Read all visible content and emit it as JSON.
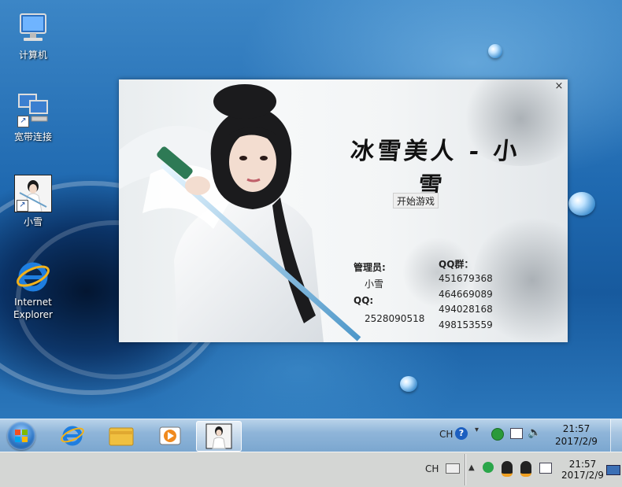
{
  "desktop": {
    "icons": [
      {
        "label": "计算机",
        "icon": "computer-icon"
      },
      {
        "label": "宽带连接",
        "icon": "network-connection-icon"
      },
      {
        "label": "小雪",
        "icon": "game-shortcut-icon"
      },
      {
        "label": "Internet Explorer",
        "icon": "ie-icon"
      }
    ]
  },
  "game": {
    "title": "冰雪美人 - 小雪",
    "close": "×",
    "start_label": "开始游戏",
    "admin_label": "管理员:",
    "admin_name": "小雪",
    "qq_label": "QQ:",
    "qq_number": "2528090518",
    "group_label": "QQ群：",
    "groups": [
      "451679368",
      "464669089",
      "494028168",
      "498153559"
    ]
  },
  "taskbar": {
    "lang": "CH",
    "time": "21:57",
    "date": "2017/2/9",
    "pinned": [
      "ie-icon",
      "explorer-icon",
      "media-player-icon",
      "game-icon"
    ]
  },
  "host_taskbar": {
    "lang": "CH",
    "time": "21:57",
    "date": "2017/2/9"
  },
  "colors": {
    "desktop_blue": "#1f69b0",
    "taskbar": "#8fb5d9",
    "host_bar": "#d4d6d4"
  }
}
